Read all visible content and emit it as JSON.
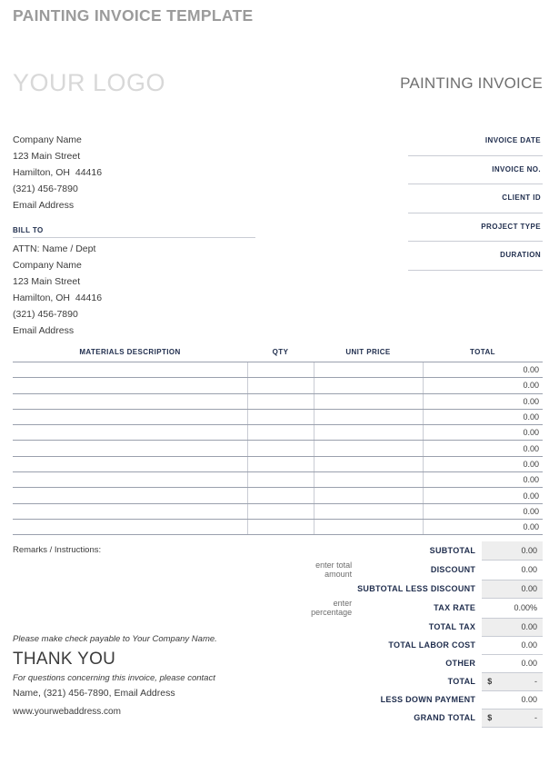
{
  "page_title": "PAINTING INVOICE TEMPLATE",
  "logo_text": "YOUR LOGO",
  "doc_heading": "PAINTING INVOICE",
  "from": {
    "lines": [
      "Company Name",
      "123 Main Street",
      "Hamilton, OH  44416",
      "(321) 456-7890",
      "Email Address"
    ]
  },
  "bill_to": {
    "label": "BILL TO",
    "lines": [
      "ATTN: Name / Dept",
      "Company Name",
      "123 Main Street",
      "Hamilton, OH  44416",
      "(321) 456-7890",
      "Email Address"
    ]
  },
  "meta_fields": [
    {
      "label": "INVOICE DATE",
      "value": ""
    },
    {
      "label": "INVOICE NO.",
      "value": ""
    },
    {
      "label": "CLIENT ID",
      "value": ""
    },
    {
      "label": "PROJECT TYPE",
      "value": ""
    },
    {
      "label": "DURATION",
      "value": ""
    }
  ],
  "items_table": {
    "columns": [
      "MATERIALS DESCRIPTION",
      "QTY",
      "UNIT PRICE",
      "TOTAL"
    ],
    "rows": [
      {
        "description": "",
        "qty": "",
        "unit_price": "",
        "total": "0.00"
      },
      {
        "description": "",
        "qty": "",
        "unit_price": "",
        "total": "0.00"
      },
      {
        "description": "",
        "qty": "",
        "unit_price": "",
        "total": "0.00"
      },
      {
        "description": "",
        "qty": "",
        "unit_price": "",
        "total": "0.00"
      },
      {
        "description": "",
        "qty": "",
        "unit_price": "",
        "total": "0.00"
      },
      {
        "description": "",
        "qty": "",
        "unit_price": "",
        "total": "0.00"
      },
      {
        "description": "",
        "qty": "",
        "unit_price": "",
        "total": "0.00"
      },
      {
        "description": "",
        "qty": "",
        "unit_price": "",
        "total": "0.00"
      },
      {
        "description": "",
        "qty": "",
        "unit_price": "",
        "total": "0.00"
      },
      {
        "description": "",
        "qty": "",
        "unit_price": "",
        "total": "0.00"
      },
      {
        "description": "",
        "qty": "",
        "unit_price": "",
        "total": "0.00"
      }
    ]
  },
  "remarks_label": "Remarks / Instructions:",
  "totals": [
    {
      "hint": "",
      "label": "SUBTOTAL",
      "currency": "",
      "value": "0.00",
      "shaded": true
    },
    {
      "hint": "enter total amount",
      "label": "DISCOUNT",
      "currency": "",
      "value": "0.00",
      "shaded": false
    },
    {
      "hint": "",
      "label": "SUBTOTAL LESS DISCOUNT",
      "currency": "",
      "value": "0.00",
      "shaded": true
    },
    {
      "hint": "enter percentage",
      "label": "TAX RATE",
      "currency": "",
      "value": "0.00%",
      "shaded": false
    },
    {
      "hint": "",
      "label": "TOTAL TAX",
      "currency": "",
      "value": "0.00",
      "shaded": true
    },
    {
      "hint": "",
      "label": "TOTAL LABOR COST",
      "currency": "",
      "value": "0.00",
      "shaded": false
    },
    {
      "hint": "",
      "label": "OTHER",
      "currency": "",
      "value": "0.00",
      "shaded": false
    },
    {
      "hint": "",
      "label": "TOTAL",
      "currency": "$",
      "value": "-",
      "shaded": true
    },
    {
      "hint": "",
      "label": "LESS DOWN PAYMENT",
      "currency": "",
      "value": "0.00",
      "shaded": false
    },
    {
      "hint": "",
      "label": "GRAND TOTAL",
      "currency": "$",
      "value": "-",
      "shaded": true
    }
  ],
  "closing": {
    "payable": "Please make check payable to Your Company Name.",
    "thanks": "THANK YOU",
    "questions": "For questions concerning this invoice, please contact",
    "contact": "Name, (321) 456-7890, Email Address",
    "weburl": "www.yourwebaddress.com"
  }
}
